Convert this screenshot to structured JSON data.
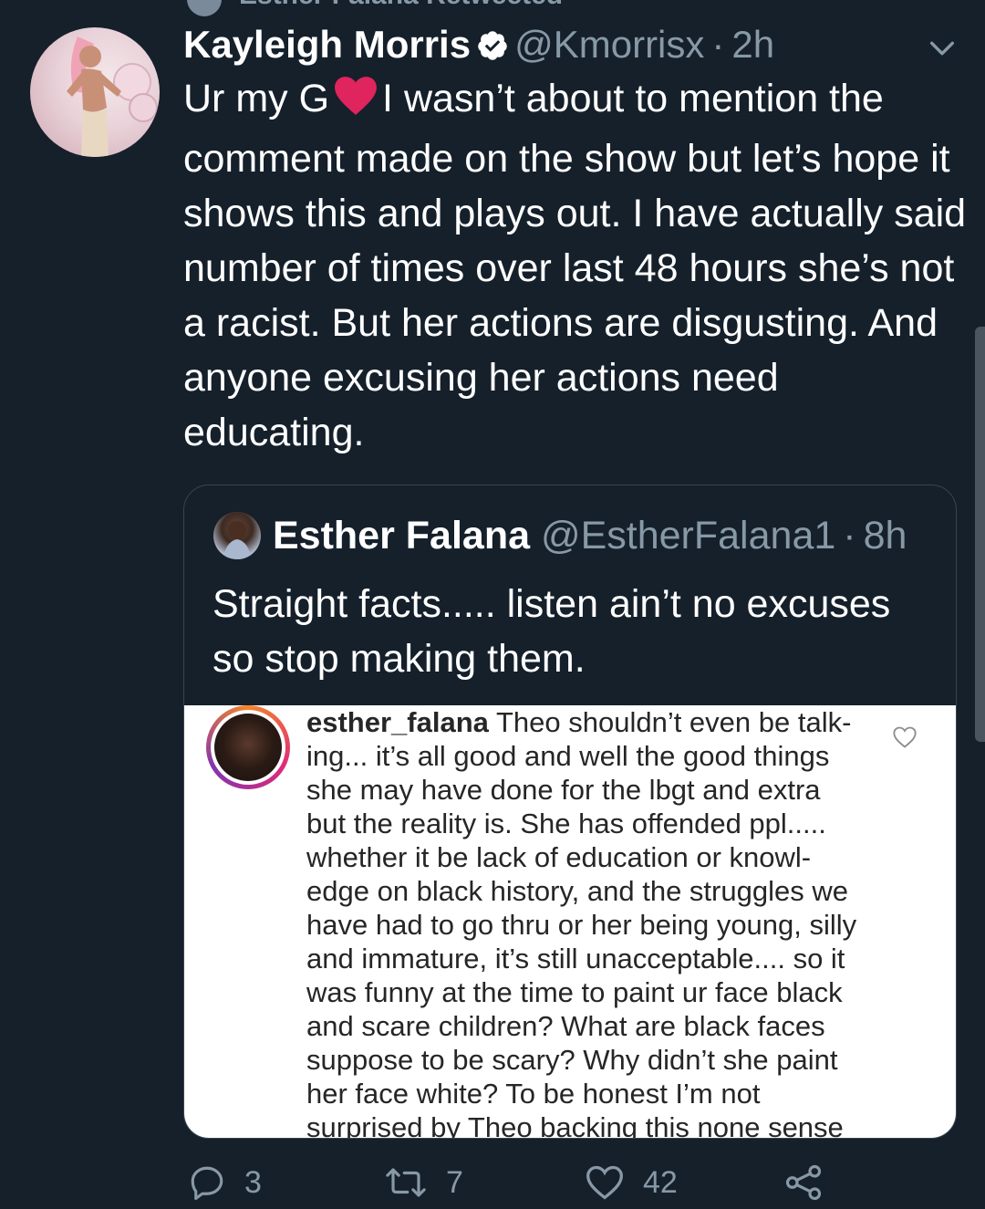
{
  "retweet_header": {
    "text": "Esther Falana Retweeted"
  },
  "tweet": {
    "author_name": "Kayleigh Morris",
    "handle": "@Kmorrisx",
    "time_sep": "·",
    "time": "2h",
    "text_before_emoji": "Ur my G",
    "emoji": "red-heart",
    "text_after_emoji": "I wasn’t about to mention the comment made on the show but let’s hope it shows this and plays out. I have actually said number of times over last 48 hours she’s not a racist. But her actions are disgusting. And anyone excusing her actions need educating."
  },
  "quote": {
    "author_name": "Esther Falana",
    "handle": "@EstherFalana1",
    "time_sep": "·",
    "time": "8h",
    "text": "Straight facts..... listen ain’t no excuses so stop making them.",
    "image_comment": {
      "username": "esther_falana",
      "text": "Theo shouldn’t even be talk-ing... it’s all good and well the good things she may have done for the lbgt and extra but the reality is. She has offended ppl..... whether it be lack of education or knowl-edge on black history, and the struggles we have had to go thru or her being young, silly and immature, it’s still unacceptable.... so it was funny at the time to paint ur face black and scare children? What are black faces suppose to be scary? Why didn’t she paint her face white? To be honest I’m not surprised by Theo backing this none sense"
    }
  },
  "actions": {
    "reply_count": "3",
    "retweet_count": "7",
    "like_count": "42"
  },
  "colors": {
    "background": "#15202b",
    "secondary_text": "#8899a6",
    "border": "#38444d",
    "heart": "#e0245e"
  }
}
